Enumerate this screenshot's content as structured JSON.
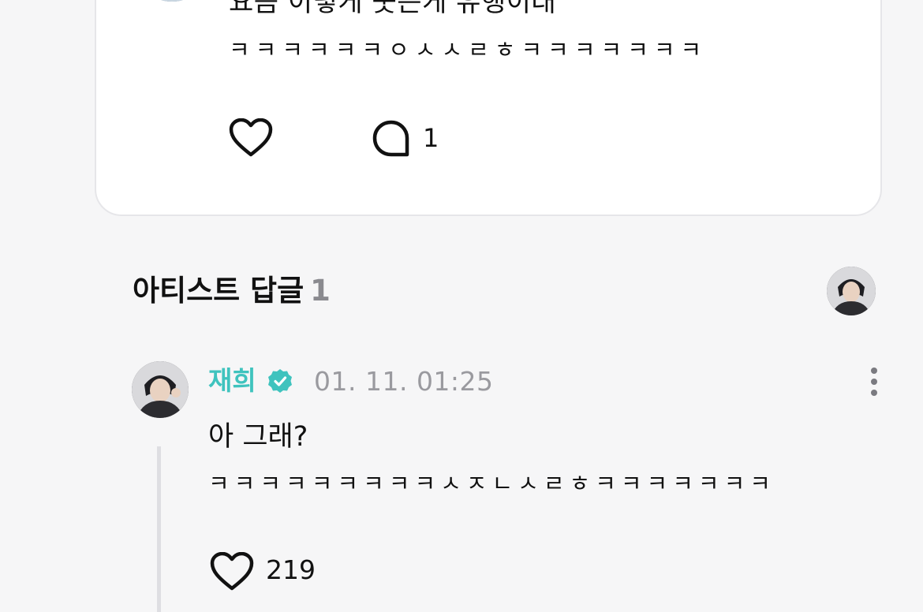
{
  "post": {
    "avatar_icon": "user-avatar",
    "line1": "요즘 이렇게 웃는게 유행이래",
    "line2": "ㅋㅋㅋㅋㅋㅋㅇㅅㅅㄹㅎㅋㅋㅋㅋㅋㅋㅋ",
    "like_icon": "heart-icon",
    "comment_icon": "comment-bubble-icon",
    "comment_count": "1"
  },
  "artist_replies": {
    "title": "아티스트 답글",
    "count": "1",
    "artist_avatar_icon": "artist-avatar"
  },
  "reply": {
    "author": "재희",
    "verified_icon": "verified-badge-icon",
    "verified_color": "#3fc3be",
    "timestamp": "01. 11. 01:25",
    "more_icon": "more-vertical-icon",
    "line1": "아 그래?",
    "line2": "ㅋㅋㅋㅋㅋㅋㅋㅋㅋㅅㅈㄴㅅㄹㅎㅋㅋㅋㅋㅋㅋㅋ",
    "like_icon": "heart-icon",
    "like_count": "219"
  },
  "colors": {
    "background": "#f6f6f7",
    "card": "#ffffff",
    "accent_teal": "#3fc3be",
    "muted_text": "#9a9a9f"
  }
}
